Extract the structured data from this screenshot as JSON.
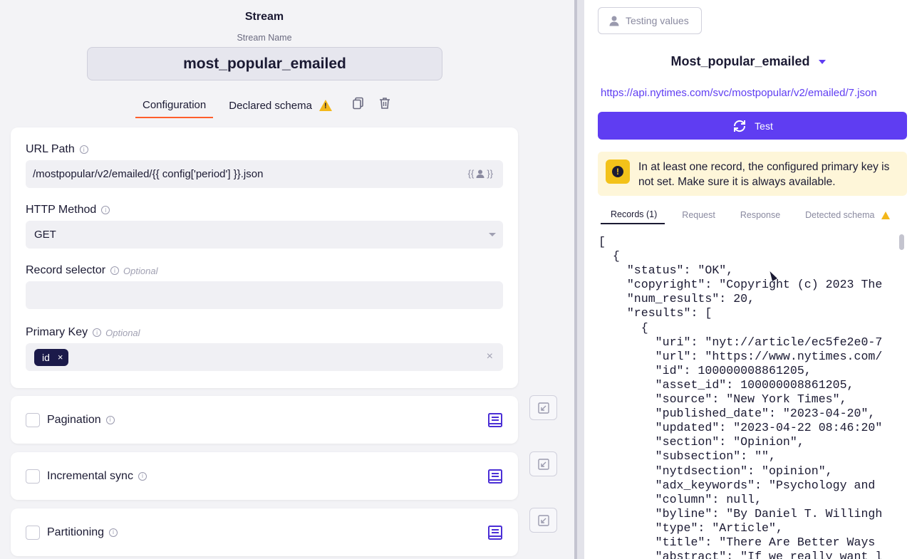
{
  "builder": {
    "title": "Stream",
    "stream_name_label": "Stream Name",
    "stream_name": "most_popular_emailed",
    "tabs": {
      "configuration": "Configuration",
      "declared_schema": "Declared schema"
    },
    "fields": {
      "url_path": {
        "label": "URL Path",
        "value": "/mostpopular/v2/emailed/{{ config['period'] }}.json",
        "user_input_hint": "{{"
      },
      "http_method": {
        "label": "HTTP Method",
        "value": "GET"
      },
      "record_selector": {
        "label": "Record selector",
        "optional": "Optional",
        "value": ""
      },
      "primary_key": {
        "label": "Primary Key",
        "optional": "Optional",
        "chip": "id",
        "chip_remove": "×",
        "clear": "×"
      }
    },
    "sections": [
      {
        "label": "Pagination"
      },
      {
        "label": "Incremental sync"
      },
      {
        "label": "Partitioning"
      }
    ]
  },
  "tester": {
    "testing_values_label": "Testing values",
    "stream_selected": "Most_popular_emailed",
    "api_url": "https://api.nytimes.com/svc/mostpopular/v2/emailed/7.json",
    "test_label": "Test",
    "warning": "In at least one record, the configured primary key is not set. Make sure it is always available.",
    "result_tabs": {
      "records": "Records (1)",
      "request": "Request",
      "response": "Response",
      "detected_schema": "Detected schema"
    },
    "json_lines": [
      "[",
      "  {",
      "    \"status\": \"OK\",",
      "    \"copyright\": \"Copyright (c) 2023 The",
      "    \"num_results\": 20,",
      "    \"results\": [",
      "      {",
      "        \"uri\": \"nyt://article/ec5fe2e0-7",
      "        \"url\": \"https://www.nytimes.com/",
      "        \"id\": 100000008861205,",
      "        \"asset_id\": 100000008861205,",
      "        \"source\": \"New York Times\",",
      "        \"published_date\": \"2023-04-20\",",
      "        \"updated\": \"2023-04-22 08:46:20\"",
      "        \"section\": \"Opinion\",",
      "        \"subsection\": \"\",",
      "        \"nytdsection\": \"opinion\",",
      "        \"adx_keywords\": \"Psychology and",
      "        \"column\": null,",
      "        \"byline\": \"By Daniel T. Willingh",
      "        \"type\": \"Article\",",
      "        \"title\": \"There Are Better Ways",
      "        \"abstract\": \"If we really want l"
    ]
  },
  "colors": {
    "accent": "#5f3df2",
    "tab_underline": "#ff5e2c",
    "warning": "#f3c21a",
    "chip_bg": "#1b1a4a"
  }
}
